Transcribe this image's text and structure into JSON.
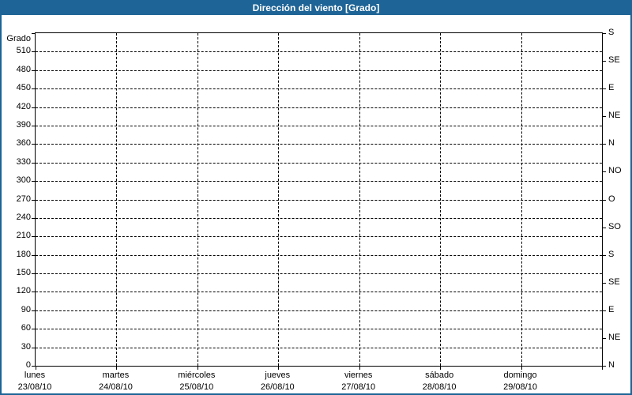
{
  "window": {
    "title": "Dirección del viento [Grado]"
  },
  "colors": {
    "titlebar_bg": "#1e6496",
    "titlebar_text": "#ffffff",
    "frame_border": "#1e6496",
    "plot_bg": "#ffffff",
    "grid": "#000000",
    "text": "#000000"
  },
  "chart_data": {
    "type": "line",
    "title": "Dirección del viento [Grado]",
    "series": [],
    "grid": {
      "style": "dashed",
      "color": "#000000"
    },
    "left_axis": {
      "title": "Grado",
      "min": 0,
      "max": 540,
      "tick_step": 30,
      "ticks": [
        0,
        30,
        60,
        90,
        120,
        150,
        180,
        210,
        240,
        270,
        300,
        330,
        360,
        390,
        420,
        450,
        480,
        510
      ]
    },
    "right_axis": {
      "tick_step": 45,
      "ticks": [
        {
          "deg": 540,
          "label": "S"
        },
        {
          "deg": 495,
          "label": "SE"
        },
        {
          "deg": 450,
          "label": "E"
        },
        {
          "deg": 405,
          "label": "NE"
        },
        {
          "deg": 360,
          "label": "N"
        },
        {
          "deg": 315,
          "label": "NO"
        },
        {
          "deg": 270,
          "label": "O"
        },
        {
          "deg": 225,
          "label": "SO"
        },
        {
          "deg": 180,
          "label": "S"
        },
        {
          "deg": 135,
          "label": "SE"
        },
        {
          "deg": 90,
          "label": "E"
        },
        {
          "deg": 45,
          "label": "NE"
        },
        {
          "deg": 0,
          "label": "N"
        }
      ]
    },
    "x_axis": {
      "days": [
        {
          "name": "lunes",
          "date": "23/08/10"
        },
        {
          "name": "martes",
          "date": "24/08/10"
        },
        {
          "name": "miércoles",
          "date": "25/08/10"
        },
        {
          "name": "jueves",
          "date": "26/08/10"
        },
        {
          "name": "viernes",
          "date": "27/08/10"
        },
        {
          "name": "sábado",
          "date": "28/08/10"
        },
        {
          "name": "domingo",
          "date": "29/08/10"
        }
      ]
    }
  }
}
